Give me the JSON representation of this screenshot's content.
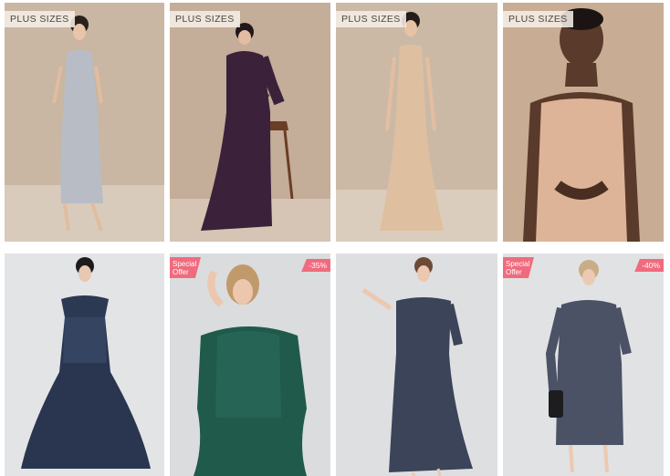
{
  "grid": {
    "row1": [
      {
        "tag": "PLUS SIZES",
        "dress": "grey satin cowl-neck midi dress"
      },
      {
        "tag": "PLUS SIZES",
        "dress": "plum satin v-neck gown"
      },
      {
        "tag": "PLUS SIZES",
        "dress": "champagne halter gown"
      },
      {
        "tag": "PLUS SIZES",
        "dress": "blush satin cowl-neck slip dress"
      }
    ],
    "row2": [
      {
        "badge": "",
        "discount": "",
        "dress": "navy off-shoulder lace gown"
      },
      {
        "badge": "Special Offer",
        "discount": "-35%",
        "dress": "emerald lace dress"
      },
      {
        "badge": "",
        "discount": "",
        "dress": "slate off-shoulder lace dress"
      },
      {
        "badge": "Special Offer",
        "discount": "-40%",
        "dress": "slate lace sheath dress"
      }
    ]
  },
  "colors": {
    "badge": "#f06b7e",
    "tag_bg": "#f5eee6",
    "row1_bg": [
      "#c9b6a3",
      "#c4ad99",
      "#cbb9a6",
      "#c8ad94"
    ],
    "row2_bg": [
      "#e2e4e6",
      "#dadcdd",
      "#dddfe1",
      "#e1e2e3"
    ]
  }
}
